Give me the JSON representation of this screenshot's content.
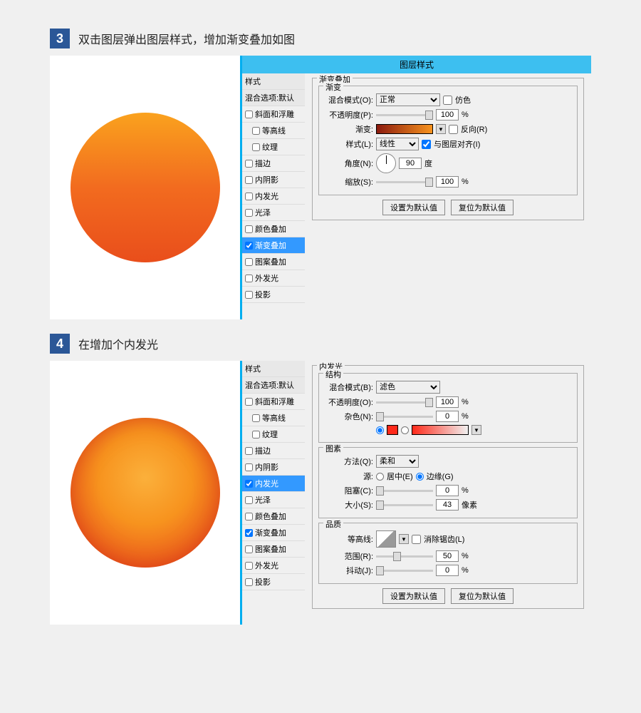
{
  "step3": {
    "num": "3",
    "title": "双击图层弹出图层样式，增加渐变叠加如图",
    "dialog_title": "图层样式",
    "styles_header": "样式",
    "blend_header": "混合选项:默认",
    "items": [
      "斜面和浮雕",
      "等高线",
      "纹理",
      "描边",
      "内阴影",
      "内发光",
      "光泽",
      "颜色叠加",
      "渐变叠加",
      "图案叠加",
      "外发光",
      "投影"
    ],
    "section_title": "渐变叠加",
    "subsection": "渐变",
    "blend_mode_lbl": "混合模式(O):",
    "blend_mode_val": "正常",
    "dither": "仿色",
    "opacity_lbl": "不透明度(P):",
    "opacity_val": "100",
    "pct": "%",
    "gradient_lbl": "渐变:",
    "reverse": "反向(R)",
    "style_lbl": "样式(L):",
    "style_val": "线性",
    "align": "与图层对齐(I)",
    "angle_lbl": "角度(N):",
    "angle_val": "90",
    "angle_unit": "度",
    "scale_lbl": "缩放(S):",
    "scale_val": "100",
    "btn_default": "设置为默认值",
    "btn_reset": "复位为默认值"
  },
  "step4": {
    "num": "4",
    "title": "在增加个内发光",
    "styles_header": "样式",
    "blend_header": "混合选项:默认",
    "items": [
      "斜面和浮雕",
      "等高线",
      "纹理",
      "描边",
      "内阴影",
      "内发光",
      "光泽",
      "颜色叠加",
      "渐变叠加",
      "图案叠加",
      "外发光",
      "投影"
    ],
    "section_title": "内发光",
    "structure": "结构",
    "blend_mode_lbl": "混合模式(B):",
    "blend_mode_val": "滤色",
    "opacity_lbl": "不透明度(O):",
    "opacity_val": "100",
    "noise_lbl": "杂色(N):",
    "noise_val": "0",
    "elements": "图素",
    "method_lbl": "方法(Q):",
    "method_val": "柔和",
    "source_lbl": "源:",
    "source_center": "居中(E)",
    "source_edge": "边缘(G)",
    "choke_lbl": "阻塞(C):",
    "choke_val": "0",
    "size_lbl": "大小(S):",
    "size_val": "43",
    "px": "像素",
    "quality": "品质",
    "contour_lbl": "等高线:",
    "antialias": "消除锯齿(L)",
    "range_lbl": "范围(R):",
    "range_val": "50",
    "jitter_lbl": "抖动(J):",
    "jitter_val": "0",
    "pct": "%",
    "btn_default": "设置为默认值",
    "btn_reset": "复位为默认值"
  }
}
